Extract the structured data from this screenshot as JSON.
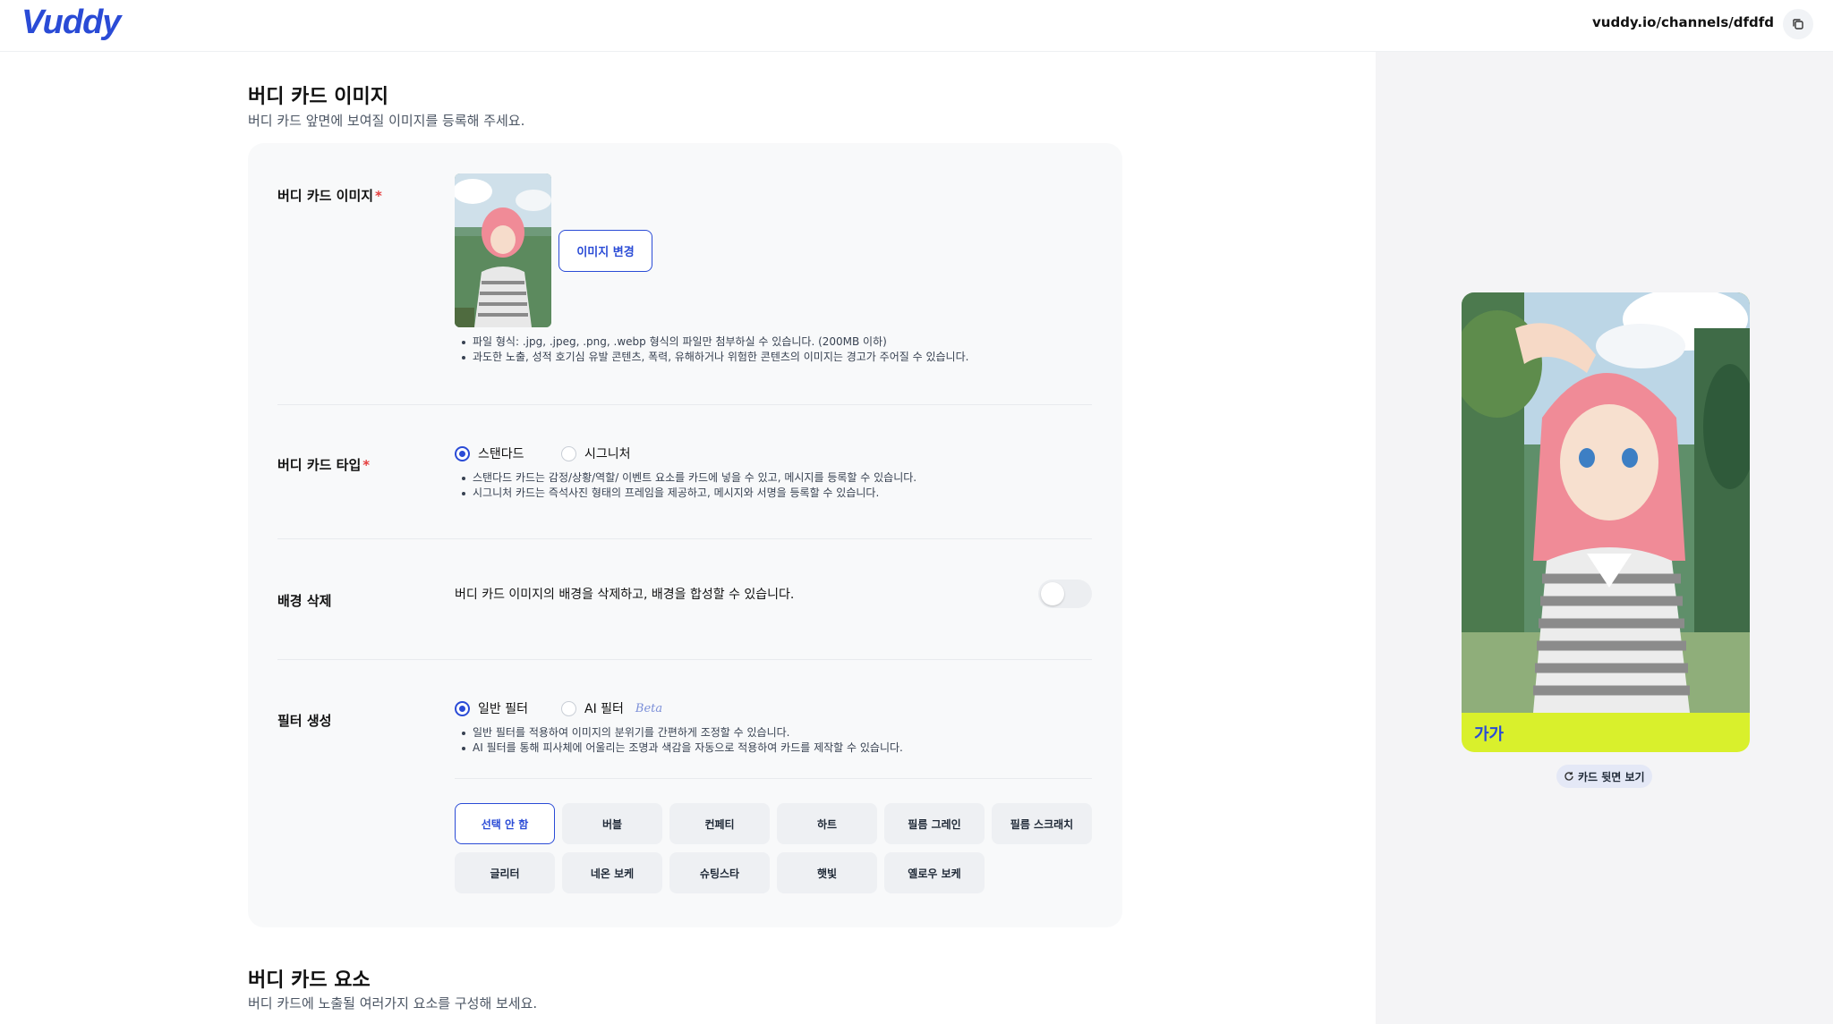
{
  "header": {
    "logo": "Vuddy",
    "url": "vuddy.io/channels/dfdfd",
    "copy_icon": "copy-icon"
  },
  "section1": {
    "title": "버디 카드 이미지",
    "subtitle": "버디 카드 앞면에 보여질 이미지를 등록해 주세요."
  },
  "image_row": {
    "label": "버디 카드 이미지",
    "required_mark": "*",
    "change_button": "이미지 변경",
    "notes": [
      "파일 형식: .jpg, .jpeg, .png, .webp 형식의 파일만 첨부하실 수 있습니다. (200MB 이하)",
      "과도한 노출, 성적 호기심 유발 콘텐츠, 폭력, 유해하거나 위험한 콘텐츠의 이미지는 경고가 주어질 수 있습니다."
    ]
  },
  "type_row": {
    "label": "버디 카드 타입",
    "required_mark": "*",
    "options": [
      {
        "label": "스탠다드",
        "selected": true
      },
      {
        "label": "시그니처",
        "selected": false
      }
    ],
    "notes": [
      "스탠다드 카드는 감정/상황/역할/ 이벤트 요소를 카드에 넣을 수 있고, 메시지를 등록할 수 있습니다.",
      "시그니처 카드는 즉석사진 형태의 프레임을 제공하고, 메시지와 서명을 등록할 수 있습니다."
    ]
  },
  "bg_row": {
    "label": "배경 삭제",
    "description": "버디 카드 이미지의 배경을 삭제하고, 배경을 합성할 수 있습니다.",
    "enabled": false
  },
  "filter_row": {
    "label": "필터 생성",
    "options": [
      {
        "label": "일반 필터",
        "selected": true
      },
      {
        "label": "AI 필터",
        "selected": false,
        "badge": "Beta"
      }
    ],
    "notes": [
      "일반 필터를 적용하여 이미지의 분위기를 간편하게 조정할 수 있습니다.",
      "AI 필터를 통해 피사체에 어울리는 조명과 색감을 자동으로 적용하여 카드를 제작할 수 있습니다."
    ],
    "filters": [
      "선택 안 함",
      "버블",
      "컨페티",
      "하트",
      "필름 그레인",
      "필름 스크래치",
      "글리터",
      "네온 보케",
      "슈팅스타",
      "햇빛",
      "옐로우 보케"
    ],
    "active_filter": "선택 안 함"
  },
  "section2": {
    "title": "버디 카드 요소",
    "subtitle": "버디 카드에 노출될 여러가지 요소를 구성해 보세요."
  },
  "preview": {
    "card_name": "가가",
    "card_color": "#d9f02c",
    "back_button": "카드 뒷면 보기",
    "refresh_icon": "refresh-icon"
  },
  "colors": {
    "accent": "#2a4bd6",
    "required": "#e53e3e"
  }
}
